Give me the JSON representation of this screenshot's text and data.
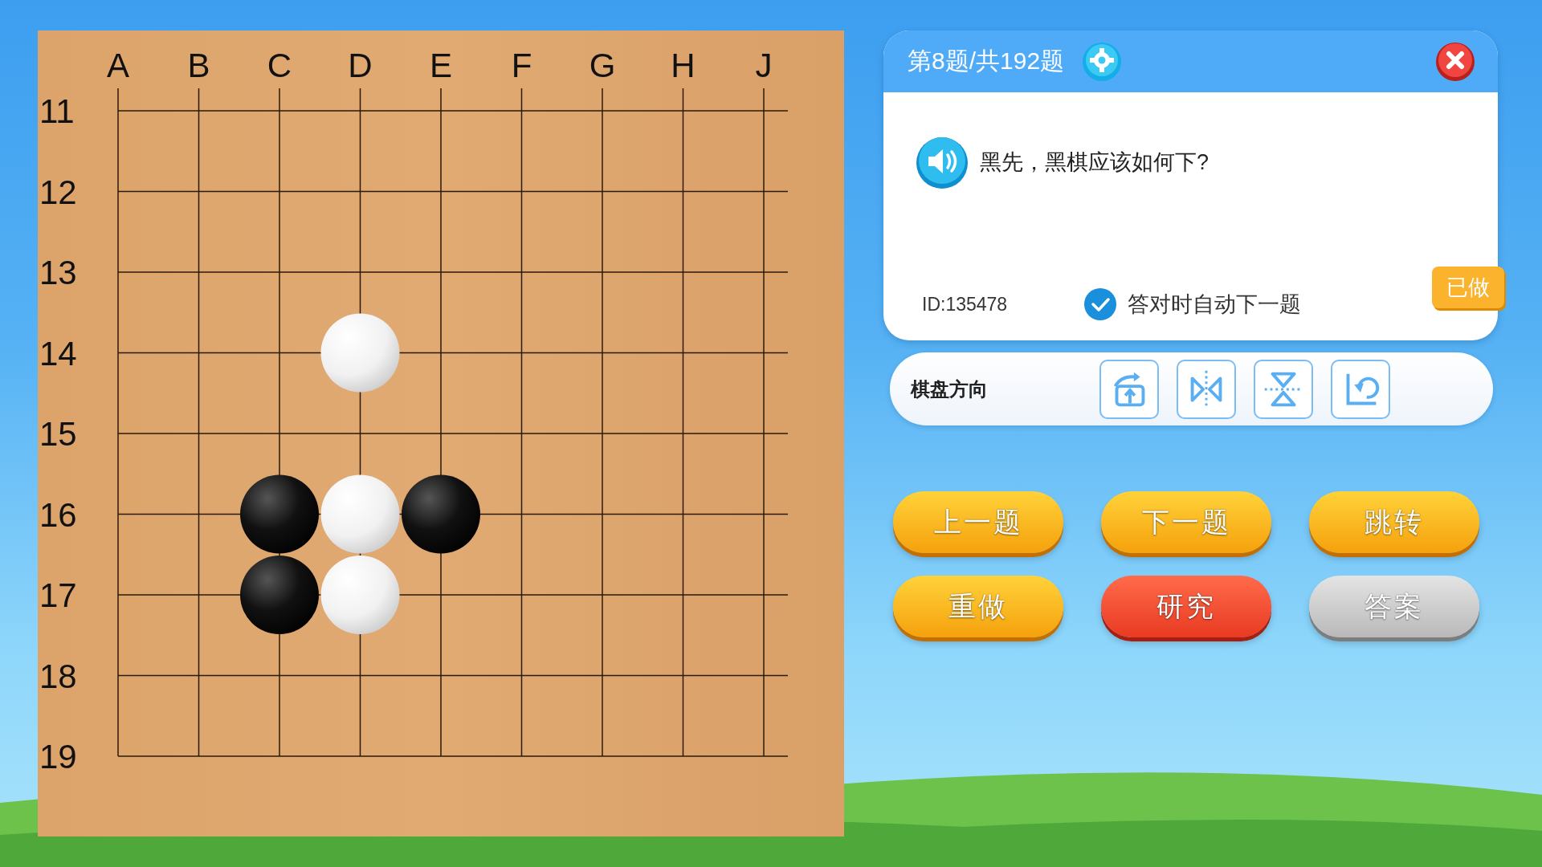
{
  "board": {
    "columns": [
      "A",
      "B",
      "C",
      "D",
      "E",
      "F",
      "G",
      "H",
      "J"
    ],
    "rows": [
      {
        "label": "11",
        "points": [
          {
            "kind": "empty"
          },
          {
            "kind": "empty"
          },
          {
            "kind": "empty"
          },
          {
            "kind": "empty"
          },
          {
            "kind": "empty"
          },
          {
            "kind": "empty"
          },
          {
            "kind": "empty"
          },
          {
            "kind": "empty"
          },
          {
            "kind": "empty"
          }
        ]
      },
      {
        "label": "12",
        "points": [
          {
            "kind": "empty"
          },
          {
            "kind": "empty"
          },
          {
            "kind": "empty"
          },
          {
            "kind": "empty"
          },
          {
            "kind": "empty"
          },
          {
            "kind": "empty"
          },
          {
            "kind": "empty"
          },
          {
            "kind": "empty"
          },
          {
            "kind": "empty"
          }
        ]
      },
      {
        "label": "13",
        "points": [
          {
            "kind": "empty"
          },
          {
            "kind": "empty"
          },
          {
            "kind": "empty"
          },
          {
            "kind": "empty"
          },
          {
            "kind": "empty"
          },
          {
            "kind": "empty"
          },
          {
            "kind": "empty"
          },
          {
            "kind": "empty"
          },
          {
            "kind": "empty"
          }
        ]
      },
      {
        "label": "14",
        "points": [
          {
            "kind": "empty"
          },
          {
            "kind": "empty"
          },
          {
            "kind": "empty"
          },
          {
            "kind": "white"
          },
          {
            "kind": "empty"
          },
          {
            "kind": "empty"
          },
          {
            "kind": "empty"
          },
          {
            "kind": "empty"
          },
          {
            "kind": "empty"
          }
        ]
      },
      {
        "label": "15",
        "points": [
          {
            "kind": "empty"
          },
          {
            "kind": "empty"
          },
          {
            "kind": "empty"
          },
          {
            "kind": "empty"
          },
          {
            "kind": "empty"
          },
          {
            "kind": "empty"
          },
          {
            "kind": "empty"
          },
          {
            "kind": "empty"
          },
          {
            "kind": "empty"
          }
        ]
      },
      {
        "label": "16",
        "points": [
          {
            "kind": "empty"
          },
          {
            "kind": "empty"
          },
          {
            "kind": "black"
          },
          {
            "kind": "white"
          },
          {
            "kind": "black"
          },
          {
            "kind": "empty"
          },
          {
            "kind": "empty"
          },
          {
            "kind": "empty"
          },
          {
            "kind": "empty"
          }
        ]
      },
      {
        "label": "17",
        "points": [
          {
            "kind": "empty"
          },
          {
            "kind": "empty"
          },
          {
            "kind": "black"
          },
          {
            "kind": "white"
          },
          {
            "kind": "empty"
          },
          {
            "kind": "empty"
          },
          {
            "kind": "empty"
          },
          {
            "kind": "empty"
          },
          {
            "kind": "empty"
          }
        ]
      },
      {
        "label": "18",
        "points": [
          {
            "kind": "empty"
          },
          {
            "kind": "empty"
          },
          {
            "kind": "empty"
          },
          {
            "kind": "empty"
          },
          {
            "kind": "empty"
          },
          {
            "kind": "empty"
          },
          {
            "kind": "empty"
          },
          {
            "kind": "empty"
          },
          {
            "kind": "empty"
          }
        ]
      },
      {
        "label": "19",
        "points": [
          {
            "kind": "empty"
          },
          {
            "kind": "empty"
          },
          {
            "kind": "empty"
          },
          {
            "kind": "empty"
          },
          {
            "kind": "empty"
          },
          {
            "kind": "empty"
          },
          {
            "kind": "empty"
          },
          {
            "kind": "empty"
          },
          {
            "kind": "empty"
          }
        ]
      }
    ]
  },
  "panel": {
    "title": "第8题/共192题",
    "question": "黑先，黑棋应该如何下?",
    "id_label": "ID:135478",
    "auto_next": {
      "label": "答对时自动下一题",
      "checked": true
    },
    "status_badge": "已做"
  },
  "orientation": {
    "label": "棋盘方向",
    "buttons": [
      {
        "kind": "rotate"
      },
      {
        "kind": "flip-horizontal"
      },
      {
        "kind": "flip-vertical"
      },
      {
        "kind": "reset"
      }
    ]
  },
  "actions": [
    {
      "label": "上一题",
      "kind": "primary"
    },
    {
      "label": "下一题",
      "kind": "primary"
    },
    {
      "label": "跳转",
      "kind": "primary"
    },
    {
      "label": "重做",
      "kind": "primary"
    },
    {
      "label": "研究",
      "kind": "accent"
    },
    {
      "label": "答案",
      "kind": "muted"
    }
  ]
}
